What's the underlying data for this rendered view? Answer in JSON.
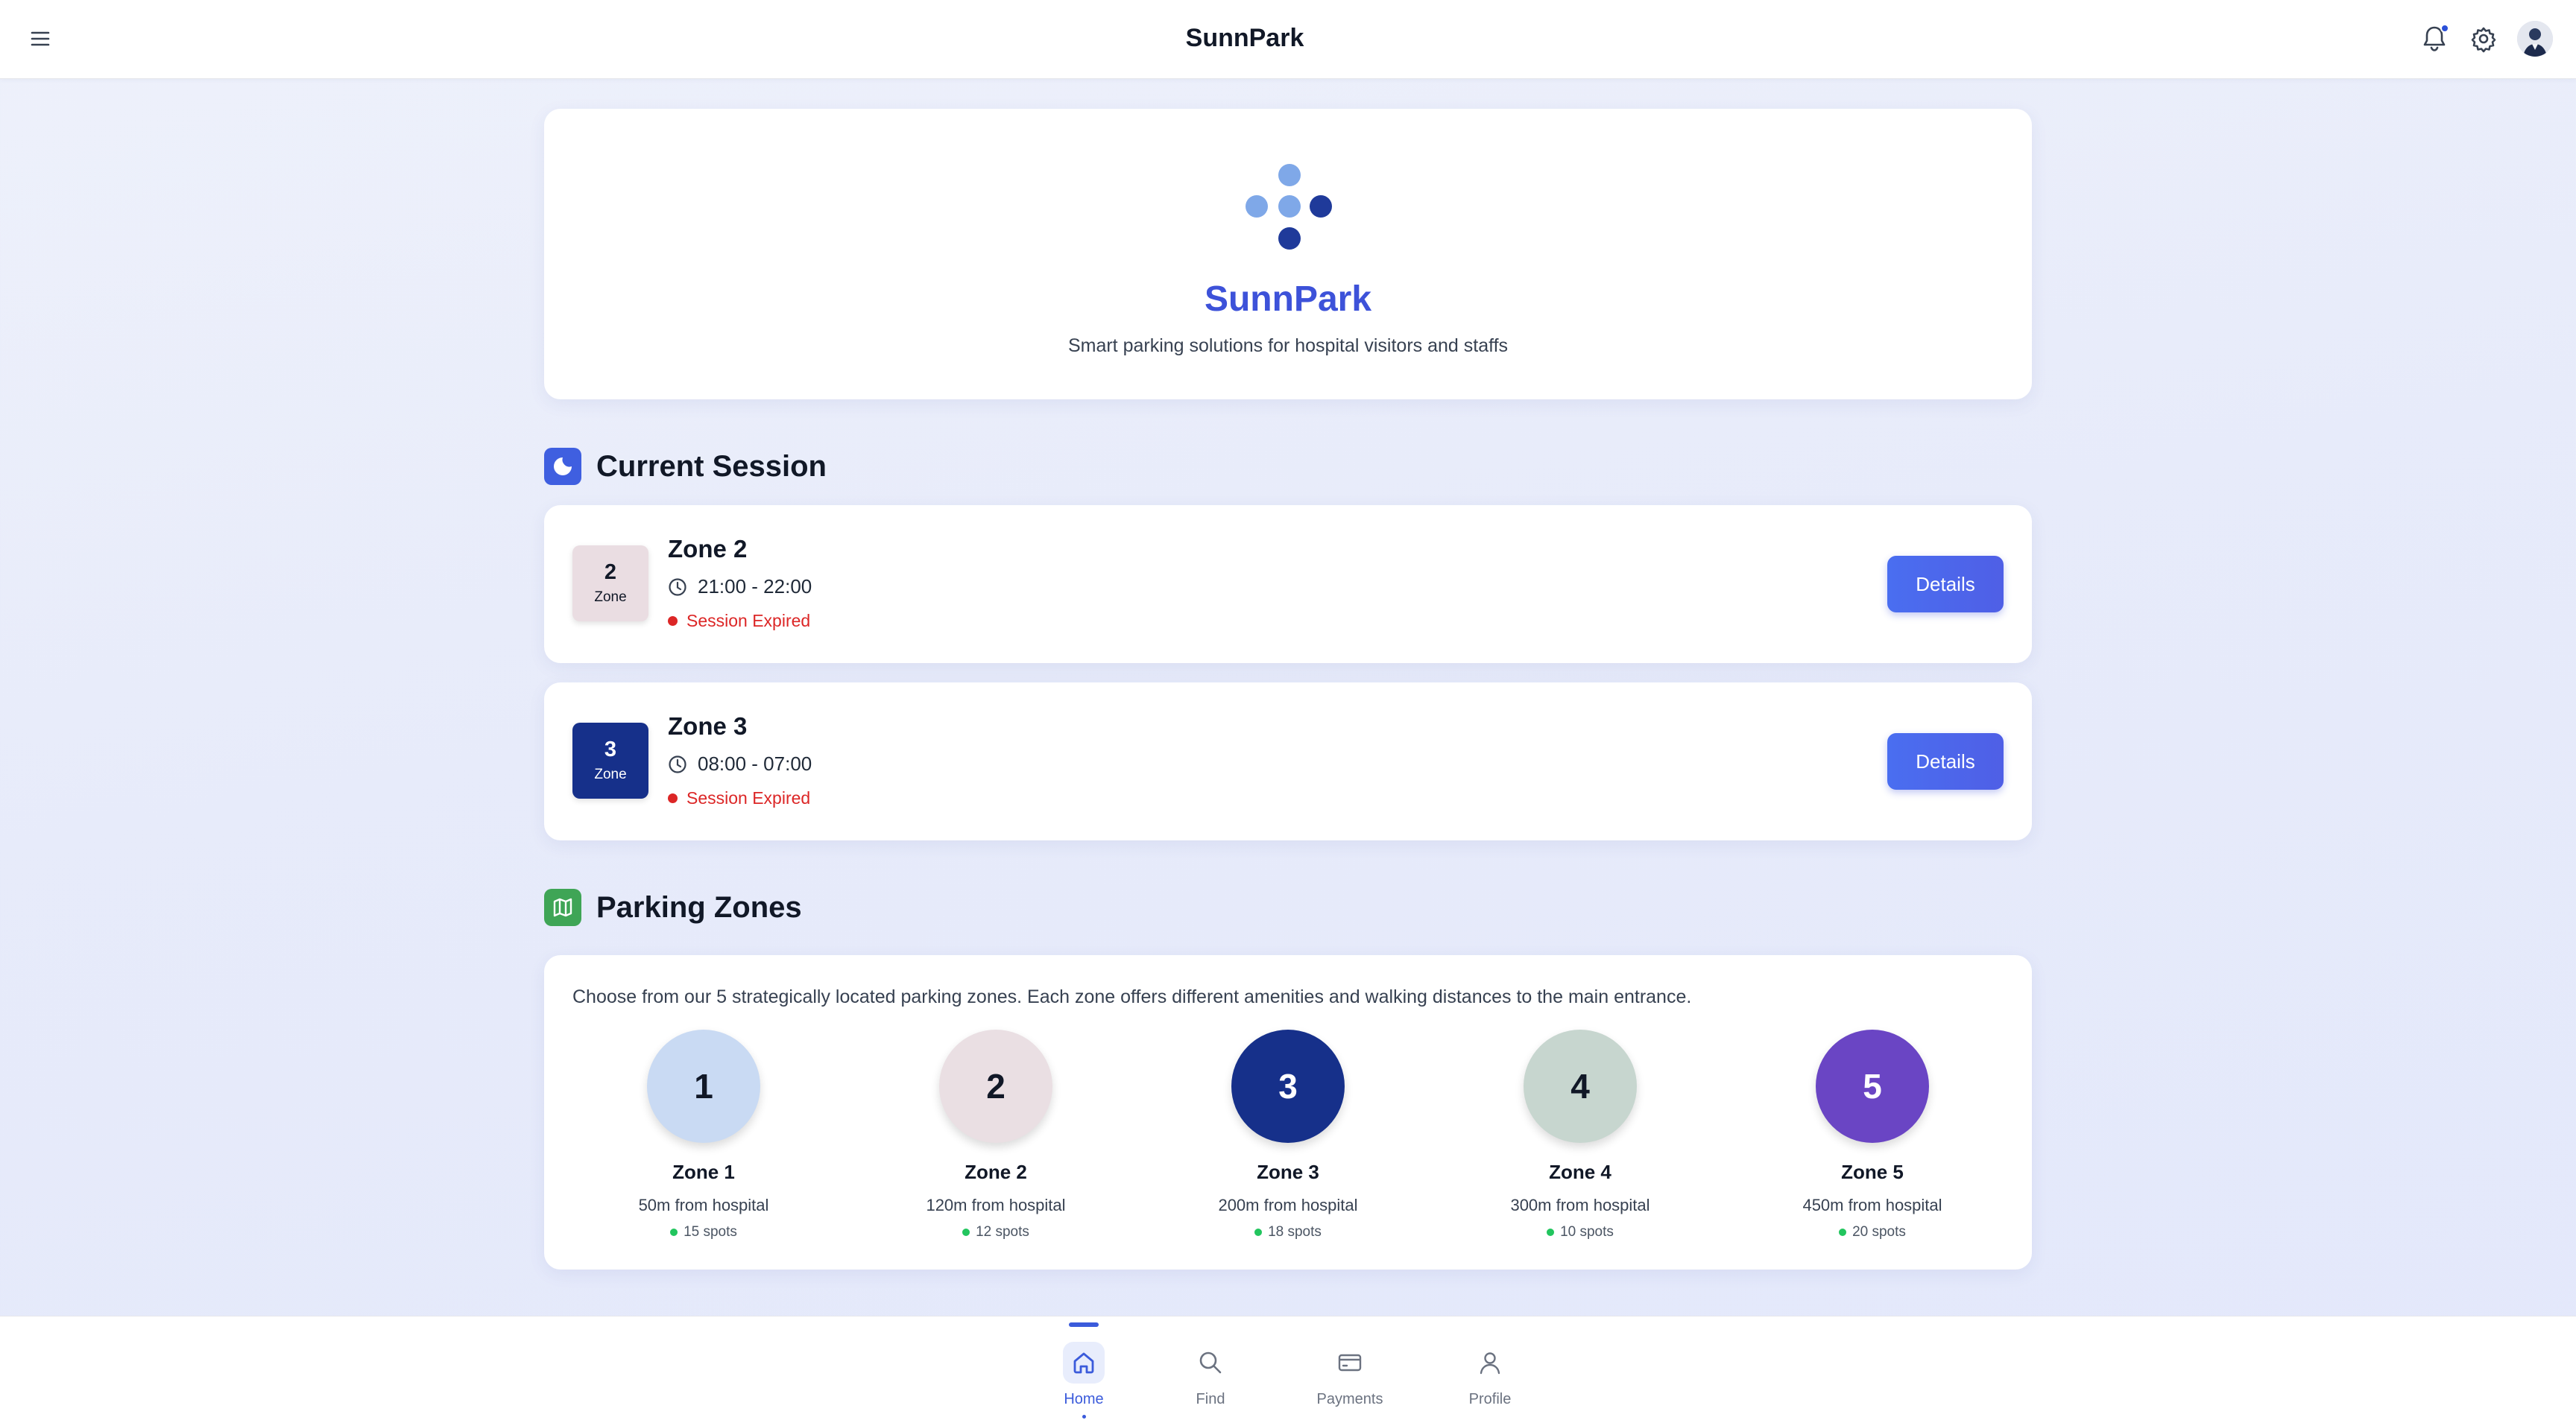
{
  "header": {
    "title": "SunnPark",
    "menu_icon": "hamburger-menu-icon",
    "notification_icon": "bell-icon",
    "settings_icon": "gear-icon",
    "avatar_icon": "user-avatar"
  },
  "hero": {
    "brand_name": "SunnPark",
    "tagline": "Smart parking solutions for hospital visitors and staffs",
    "logo_colors": [
      "#7fa8e8",
      "#1f3a9a"
    ]
  },
  "current_session": {
    "title": "Current Session",
    "icon": "moon-icon",
    "items": [
      {
        "zone_number": "2",
        "zone_label": "Zone",
        "title": "Zone 2",
        "time": "21:00 - 22:00",
        "status": "Session Expired",
        "button": "Details",
        "badge_color": "#eadde2",
        "badge_text_color": "#111827"
      },
      {
        "zone_number": "3",
        "zone_label": "Zone",
        "title": "Zone 3",
        "time": "08:00 - 07:00",
        "status": "Session Expired",
        "button": "Details",
        "badge_color": "#16308a",
        "badge_text_color": "#ffffff"
      }
    ]
  },
  "parking_zones": {
    "title": "Parking Zones",
    "icon": "map-icon",
    "description": "Choose from our 5 strategically located parking zones. Each zone offers different amenities and walking distances to the main entrance.",
    "zones": [
      {
        "number": "1",
        "name": "Zone 1",
        "distance": "50m from hospital",
        "spots": "15 spots",
        "color": "#c9daf3",
        "text_color": "#111827"
      },
      {
        "number": "2",
        "name": "Zone 2",
        "distance": "120m from hospital",
        "spots": "12 spots",
        "color": "#eadfe3",
        "text_color": "#111827"
      },
      {
        "number": "3",
        "name": "Zone 3",
        "distance": "200m from hospital",
        "spots": "18 spots",
        "color": "#16308a",
        "text_color": "#ffffff"
      },
      {
        "number": "4",
        "name": "Zone 4",
        "distance": "300m from hospital",
        "spots": "10 spots",
        "color": "#c7d6cf",
        "text_color": "#111827"
      },
      {
        "number": "5",
        "name": "Zone 5",
        "distance": "450m from hospital",
        "spots": "20 spots",
        "color": "#6a45c4",
        "text_color": "#ffffff"
      }
    ]
  },
  "bottom_nav": {
    "items": [
      {
        "label": "Home",
        "icon": "home-icon",
        "active": true
      },
      {
        "label": "Find",
        "icon": "search-icon",
        "active": false
      },
      {
        "label": "Payments",
        "icon": "credit-card-icon",
        "active": false
      },
      {
        "label": "Profile",
        "icon": "user-icon",
        "active": false
      }
    ]
  },
  "colors": {
    "accent": "#3d52d9",
    "expired": "#dc2626",
    "available": "#22c55e"
  }
}
